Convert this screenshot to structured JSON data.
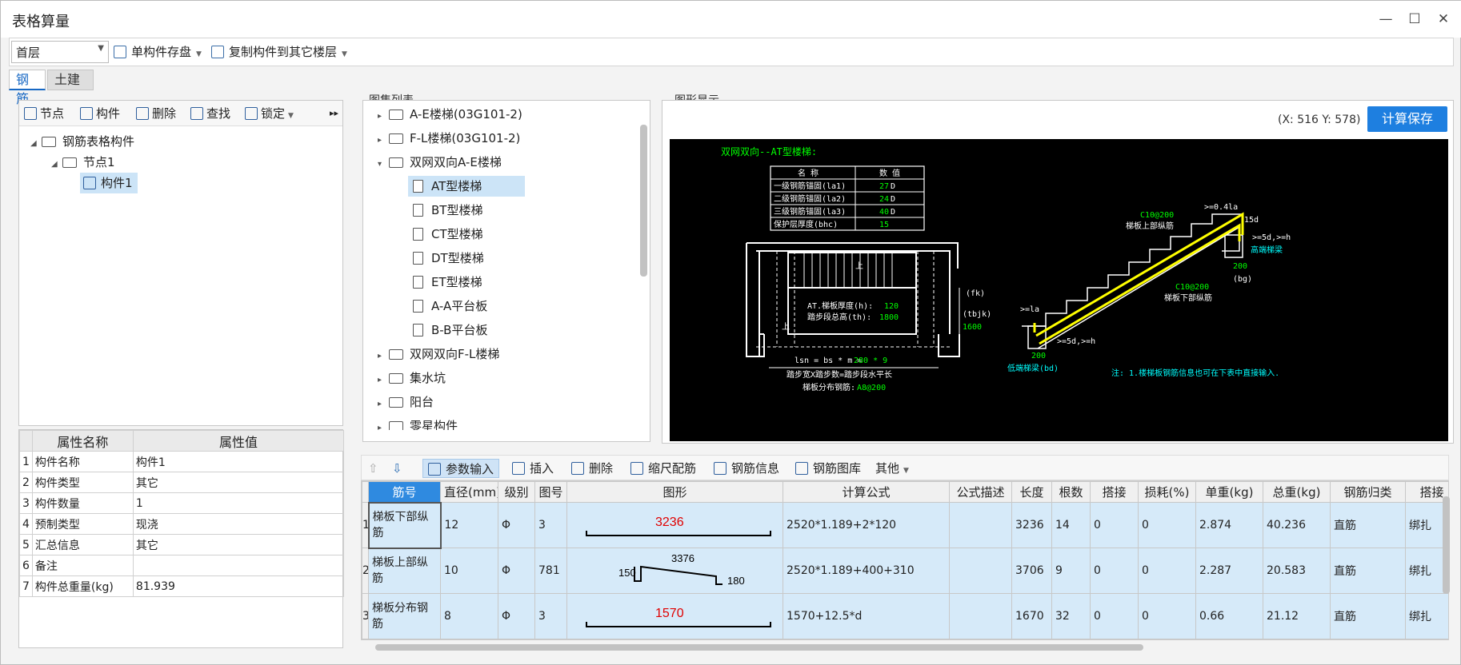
{
  "window": {
    "title": "表格算量",
    "minimize": "—",
    "maximize": "☐",
    "close": "✕"
  },
  "toolbar": {
    "floor": "首层",
    "save_single": "单构件存盘",
    "copy_to_floor": "复制构件到其它楼层"
  },
  "tabs": [
    "钢筋",
    "土建"
  ],
  "tree_toolbar": {
    "node": "节点",
    "component": "构件",
    "delete": "删除",
    "find": "查找",
    "lock": "锁定",
    "more": "▸▸"
  },
  "tree": {
    "root": "钢筋表格构件",
    "node": "节点1",
    "component": "构件1"
  },
  "props": {
    "headers": [
      "属性名称",
      "属性值"
    ],
    "rows": [
      {
        "no": "1",
        "name": "构件名称",
        "value": "构件1"
      },
      {
        "no": "2",
        "name": "构件类型",
        "value": "其它"
      },
      {
        "no": "3",
        "name": "构件数量",
        "value": "1"
      },
      {
        "no": "4",
        "name": "预制类型",
        "value": "现浇"
      },
      {
        "no": "5",
        "name": "汇总信息",
        "value": "其它"
      },
      {
        "no": "6",
        "name": "备注",
        "value": ""
      },
      {
        "no": "7",
        "name": "构件总重量(kg)",
        "value": "81.939"
      }
    ]
  },
  "atlas": {
    "title": "图集列表",
    "items": [
      {
        "label": "A-E楼梯(03G101-2)",
        "type": "folder",
        "expanded": false
      },
      {
        "label": "F-L楼梯(03G101-2)",
        "type": "folder",
        "expanded": false
      },
      {
        "label": "双网双向A-E楼梯",
        "type": "folder",
        "expanded": true
      },
      {
        "label": "AT型楼梯",
        "type": "doc",
        "selected": true
      },
      {
        "label": "BT型楼梯",
        "type": "doc"
      },
      {
        "label": "CT型楼梯",
        "type": "doc"
      },
      {
        "label": "DT型楼梯",
        "type": "doc"
      },
      {
        "label": "ET型楼梯",
        "type": "doc"
      },
      {
        "label": "A-A平台板",
        "type": "doc"
      },
      {
        "label": "B-B平台板",
        "type": "doc"
      },
      {
        "label": "双网双向F-L楼梯",
        "type": "folder",
        "expanded": false
      },
      {
        "label": "集水坑",
        "type": "folder",
        "expanded": false
      },
      {
        "label": "阳台",
        "type": "folder",
        "expanded": false
      },
      {
        "label": "零星构件",
        "type": "folder",
        "expanded": false
      }
    ]
  },
  "graphic": {
    "title": "图形显示",
    "coords": "(X: 516 Y: 578)",
    "calc_save": "计算保存"
  },
  "cad": {
    "heading": "双网双向--AT型楼梯:",
    "table_headers": [
      "名 称",
      "数 值"
    ],
    "table_rows": [
      {
        "name": "一级钢筋锚固(la1)",
        "val": "27",
        "unit": "D"
      },
      {
        "name": "二级钢筋锚固(la2)",
        "val": "24",
        "unit": "D"
      },
      {
        "name": "三级钢筋锚固(la3)",
        "val": "40",
        "unit": "D"
      },
      {
        "name": "保护层厚度(bhc)",
        "val": "15",
        "unit": ""
      }
    ],
    "thick": "AT.梯板厚度(h):",
    "thick_val": "120",
    "height": "踏步段总高(th):",
    "height_val": "1800",
    "lsn": "lsn = bs * m =",
    "lsn_val": "280 * 9",
    "step_note": "踏步宽X踏步数=踏步段水平长",
    "dist": "梯板分布钢筋:",
    "dist_val": "A8@200",
    "fk": "(fk)",
    "tbjk": "(tbjk)",
    "v1600": "1600",
    "c_top": "C10@200",
    "top_bar": "梯板上部纵筋",
    "c_bot": "C10@200",
    "bot_bar": "梯板下部纵筋",
    "hg": "高端梯梁",
    "bd": "低端梯梁(bd)",
    "v200a": "200",
    "v200b": "200",
    "bg": "(bg)",
    "d041": ">=0.4la",
    "d15": "15d",
    "d5h": ">=5d,>=h",
    "d5h2": ">=5d,>=h",
    "la": ">=la",
    "up1": "上",
    "up2": "上",
    "note": "注: 1.楼梯板钢筋信息也可在下表中直接输入."
  },
  "bottom_toolbar": {
    "param_input": "参数输入",
    "insert": "插入",
    "delete": "删除",
    "scale": "缩尺配筋",
    "info": "钢筋信息",
    "lib": "钢筋图库",
    "other": "其他"
  },
  "grid": {
    "headers": [
      "筋号",
      "直径(mm)",
      "级别",
      "图号",
      "图形",
      "计算公式",
      "公式描述",
      "长度",
      "根数",
      "搭接",
      "损耗(%)",
      "单重(kg)",
      "总重(kg)",
      "钢筋归类",
      "搭接"
    ],
    "rows": [
      {
        "no": "1",
        "name": "梯板下部纵筋",
        "dia": "12",
        "grade": "Φ",
        "fig": "3",
        "shape_text": "3236",
        "formula": "2520*1.189+2*120",
        "desc": "",
        "len": "3236",
        "count": "14",
        "lap": "0",
        "loss": "0",
        "unit": "2.874",
        "total": "40.236",
        "cls": "直筋",
        "lapt": "绑扎"
      },
      {
        "no": "2",
        "name": "梯板上部纵筋",
        "dia": "10",
        "grade": "Φ",
        "fig": "781",
        "shape_a": "150",
        "shape_b": "3376",
        "shape_c": "180",
        "formula": "2520*1.189+400+310",
        "desc": "",
        "len": "3706",
        "count": "9",
        "lap": "0",
        "loss": "0",
        "unit": "2.287",
        "total": "20.583",
        "cls": "直筋",
        "lapt": "绑扎"
      },
      {
        "no": "3",
        "name": "梯板分布钢筋",
        "dia": "8",
        "grade": "Φ",
        "fig": "3",
        "shape_text": "1570",
        "formula": "1570+12.5*d",
        "desc": "",
        "len": "1670",
        "count": "32",
        "lap": "0",
        "loss": "0",
        "unit": "0.66",
        "total": "21.12",
        "cls": "直筋",
        "lapt": "绑扎"
      }
    ]
  }
}
